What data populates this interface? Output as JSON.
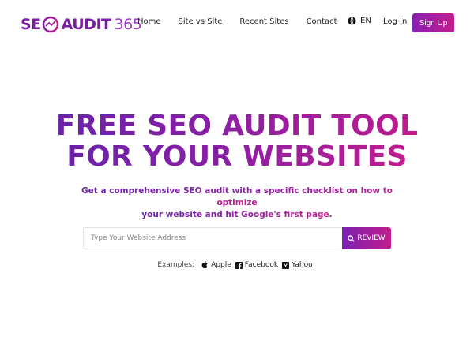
{
  "logo": {
    "seo": "SE",
    "audit": "AUDIT",
    "num": "365"
  },
  "nav": {
    "home": "Home",
    "site_vs_site": "Site vs Site",
    "recent_sites": "Recent Sites",
    "contact": "Contact"
  },
  "header": {
    "lang": "EN",
    "login": "Log In",
    "signup": "Sign Up"
  },
  "hero": {
    "title_line1": "FREE SEO AUDIT TOOL",
    "title_line2": "FOR YOUR WEBSITES",
    "subtitle_line1": "Get a comprehensive SEO audit with a specific checklist on how to optimize",
    "subtitle_line2": "your website and hit Google's first page."
  },
  "search": {
    "placeholder": "Type Your Website Address",
    "button": "REVIEW"
  },
  "examples": {
    "label": "Examples:",
    "apple": "Apple",
    "facebook": "Facebook",
    "yahoo": "Yahoo"
  },
  "colors": {
    "accent_start": "#7a22b0",
    "accent_end": "#c11d8c"
  }
}
